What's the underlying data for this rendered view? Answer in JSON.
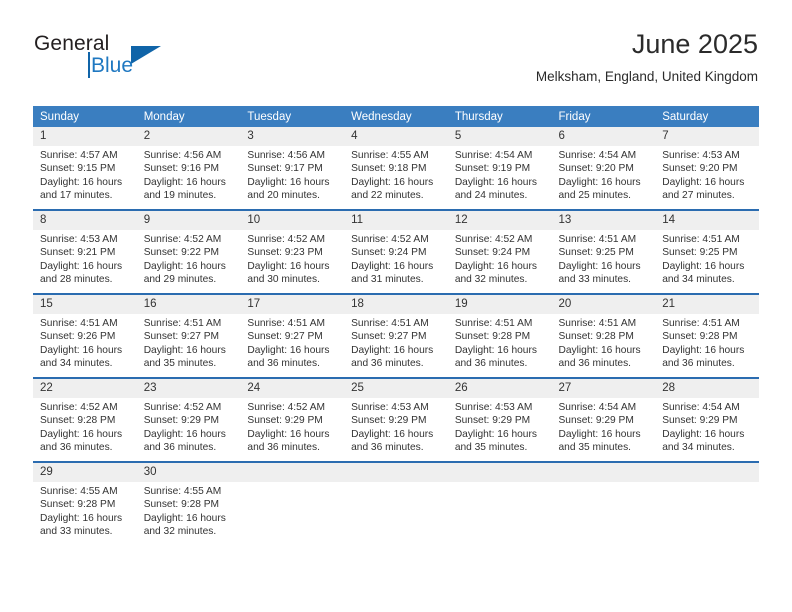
{
  "logo": {
    "word1": "General",
    "word2": "Blue",
    "accent_color": "#1064a8"
  },
  "header": {
    "title": "June 2025",
    "location": "Melksham, England, United Kingdom"
  },
  "calendar": {
    "header_background": "#3a7ec0",
    "row_divider_color": "#2b6cb0",
    "daynum_background": "#efefef",
    "weekday_headers": [
      "Sunday",
      "Monday",
      "Tuesday",
      "Wednesday",
      "Thursday",
      "Friday",
      "Saturday"
    ],
    "weeks": [
      [
        {
          "day": "1",
          "sunrise": "Sunrise: 4:57 AM",
          "sunset": "Sunset: 9:15 PM",
          "daylight1": "Daylight: 16 hours",
          "daylight2": "and 17 minutes."
        },
        {
          "day": "2",
          "sunrise": "Sunrise: 4:56 AM",
          "sunset": "Sunset: 9:16 PM",
          "daylight1": "Daylight: 16 hours",
          "daylight2": "and 19 minutes."
        },
        {
          "day": "3",
          "sunrise": "Sunrise: 4:56 AM",
          "sunset": "Sunset: 9:17 PM",
          "daylight1": "Daylight: 16 hours",
          "daylight2": "and 20 minutes."
        },
        {
          "day": "4",
          "sunrise": "Sunrise: 4:55 AM",
          "sunset": "Sunset: 9:18 PM",
          "daylight1": "Daylight: 16 hours",
          "daylight2": "and 22 minutes."
        },
        {
          "day": "5",
          "sunrise": "Sunrise: 4:54 AM",
          "sunset": "Sunset: 9:19 PM",
          "daylight1": "Daylight: 16 hours",
          "daylight2": "and 24 minutes."
        },
        {
          "day": "6",
          "sunrise": "Sunrise: 4:54 AM",
          "sunset": "Sunset: 9:20 PM",
          "daylight1": "Daylight: 16 hours",
          "daylight2": "and 25 minutes."
        },
        {
          "day": "7",
          "sunrise": "Sunrise: 4:53 AM",
          "sunset": "Sunset: 9:20 PM",
          "daylight1": "Daylight: 16 hours",
          "daylight2": "and 27 minutes."
        }
      ],
      [
        {
          "day": "8",
          "sunrise": "Sunrise: 4:53 AM",
          "sunset": "Sunset: 9:21 PM",
          "daylight1": "Daylight: 16 hours",
          "daylight2": "and 28 minutes."
        },
        {
          "day": "9",
          "sunrise": "Sunrise: 4:52 AM",
          "sunset": "Sunset: 9:22 PM",
          "daylight1": "Daylight: 16 hours",
          "daylight2": "and 29 minutes."
        },
        {
          "day": "10",
          "sunrise": "Sunrise: 4:52 AM",
          "sunset": "Sunset: 9:23 PM",
          "daylight1": "Daylight: 16 hours",
          "daylight2": "and 30 minutes."
        },
        {
          "day": "11",
          "sunrise": "Sunrise: 4:52 AM",
          "sunset": "Sunset: 9:24 PM",
          "daylight1": "Daylight: 16 hours",
          "daylight2": "and 31 minutes."
        },
        {
          "day": "12",
          "sunrise": "Sunrise: 4:52 AM",
          "sunset": "Sunset: 9:24 PM",
          "daylight1": "Daylight: 16 hours",
          "daylight2": "and 32 minutes."
        },
        {
          "day": "13",
          "sunrise": "Sunrise: 4:51 AM",
          "sunset": "Sunset: 9:25 PM",
          "daylight1": "Daylight: 16 hours",
          "daylight2": "and 33 minutes."
        },
        {
          "day": "14",
          "sunrise": "Sunrise: 4:51 AM",
          "sunset": "Sunset: 9:25 PM",
          "daylight1": "Daylight: 16 hours",
          "daylight2": "and 34 minutes."
        }
      ],
      [
        {
          "day": "15",
          "sunrise": "Sunrise: 4:51 AM",
          "sunset": "Sunset: 9:26 PM",
          "daylight1": "Daylight: 16 hours",
          "daylight2": "and 34 minutes."
        },
        {
          "day": "16",
          "sunrise": "Sunrise: 4:51 AM",
          "sunset": "Sunset: 9:27 PM",
          "daylight1": "Daylight: 16 hours",
          "daylight2": "and 35 minutes."
        },
        {
          "day": "17",
          "sunrise": "Sunrise: 4:51 AM",
          "sunset": "Sunset: 9:27 PM",
          "daylight1": "Daylight: 16 hours",
          "daylight2": "and 36 minutes."
        },
        {
          "day": "18",
          "sunrise": "Sunrise: 4:51 AM",
          "sunset": "Sunset: 9:27 PM",
          "daylight1": "Daylight: 16 hours",
          "daylight2": "and 36 minutes."
        },
        {
          "day": "19",
          "sunrise": "Sunrise: 4:51 AM",
          "sunset": "Sunset: 9:28 PM",
          "daylight1": "Daylight: 16 hours",
          "daylight2": "and 36 minutes."
        },
        {
          "day": "20",
          "sunrise": "Sunrise: 4:51 AM",
          "sunset": "Sunset: 9:28 PM",
          "daylight1": "Daylight: 16 hours",
          "daylight2": "and 36 minutes."
        },
        {
          "day": "21",
          "sunrise": "Sunrise: 4:51 AM",
          "sunset": "Sunset: 9:28 PM",
          "daylight1": "Daylight: 16 hours",
          "daylight2": "and 36 minutes."
        }
      ],
      [
        {
          "day": "22",
          "sunrise": "Sunrise: 4:52 AM",
          "sunset": "Sunset: 9:28 PM",
          "daylight1": "Daylight: 16 hours",
          "daylight2": "and 36 minutes."
        },
        {
          "day": "23",
          "sunrise": "Sunrise: 4:52 AM",
          "sunset": "Sunset: 9:29 PM",
          "daylight1": "Daylight: 16 hours",
          "daylight2": "and 36 minutes."
        },
        {
          "day": "24",
          "sunrise": "Sunrise: 4:52 AM",
          "sunset": "Sunset: 9:29 PM",
          "daylight1": "Daylight: 16 hours",
          "daylight2": "and 36 minutes."
        },
        {
          "day": "25",
          "sunrise": "Sunrise: 4:53 AM",
          "sunset": "Sunset: 9:29 PM",
          "daylight1": "Daylight: 16 hours",
          "daylight2": "and 36 minutes."
        },
        {
          "day": "26",
          "sunrise": "Sunrise: 4:53 AM",
          "sunset": "Sunset: 9:29 PM",
          "daylight1": "Daylight: 16 hours",
          "daylight2": "and 35 minutes."
        },
        {
          "day": "27",
          "sunrise": "Sunrise: 4:54 AM",
          "sunset": "Sunset: 9:29 PM",
          "daylight1": "Daylight: 16 hours",
          "daylight2": "and 35 minutes."
        },
        {
          "day": "28",
          "sunrise": "Sunrise: 4:54 AM",
          "sunset": "Sunset: 9:29 PM",
          "daylight1": "Daylight: 16 hours",
          "daylight2": "and 34 minutes."
        }
      ],
      [
        {
          "day": "29",
          "sunrise": "Sunrise: 4:55 AM",
          "sunset": "Sunset: 9:28 PM",
          "daylight1": "Daylight: 16 hours",
          "daylight2": "and 33 minutes."
        },
        {
          "day": "30",
          "sunrise": "Sunrise: 4:55 AM",
          "sunset": "Sunset: 9:28 PM",
          "daylight1": "Daylight: 16 hours",
          "daylight2": "and 32 minutes."
        },
        {
          "day": "",
          "sunrise": "",
          "sunset": "",
          "daylight1": "",
          "daylight2": ""
        },
        {
          "day": "",
          "sunrise": "",
          "sunset": "",
          "daylight1": "",
          "daylight2": ""
        },
        {
          "day": "",
          "sunrise": "",
          "sunset": "",
          "daylight1": "",
          "daylight2": ""
        },
        {
          "day": "",
          "sunrise": "",
          "sunset": "",
          "daylight1": "",
          "daylight2": ""
        },
        {
          "day": "",
          "sunrise": "",
          "sunset": "",
          "daylight1": "",
          "daylight2": ""
        }
      ]
    ]
  }
}
